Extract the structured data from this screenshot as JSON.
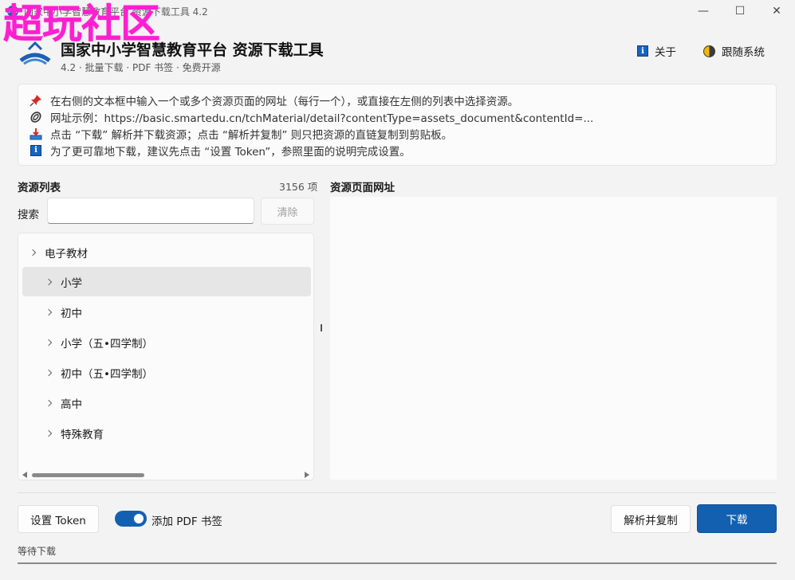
{
  "window": {
    "title": "国家中小学智慧教育平台 资源下载工具 4.2",
    "controls": {
      "minimize": "—",
      "maximize": "☐",
      "close": "✕"
    }
  },
  "watermark": "超玩社区",
  "header": {
    "title": "国家中小学智慧教育平台 资源下载工具",
    "subtitle": "4.2 · 批量下载 · PDF 书签 · 免费开源",
    "about_label": "关于",
    "theme_label": "跟随系统"
  },
  "info": {
    "lines": [
      {
        "icon": "pin-icon",
        "text": "在右侧的文本框中输入一个或多个资源页面的网址（每行一个），或直接在左侧的列表中选择资源。"
      },
      {
        "icon": "paperclip-icon",
        "text": "网址示例：https://basic.smartedu.cn/tchMaterial/detail?contentType=assets_document&contentId=..."
      },
      {
        "icon": "download-tray-icon",
        "text": "点击 “下载” 解析并下载资源；点击 “解析并复制” 则只把资源的直链复制到剪贴板。"
      },
      {
        "icon": "info-icon",
        "text": "为了更可靠地下载，建议先点击 “设置 Token”，参照里面的说明完成设置。"
      }
    ]
  },
  "resources": {
    "label": "资源列表",
    "count": "3156 项",
    "search_label": "搜索",
    "search_value": "",
    "clear_label": "清除",
    "tree": [
      {
        "label": "电子教材",
        "level": 0,
        "selected": false
      },
      {
        "label": "小学",
        "level": 1,
        "selected": true
      },
      {
        "label": "初中",
        "level": 1,
        "selected": false
      },
      {
        "label": "小学（五•四学制）",
        "level": 1,
        "selected": false
      },
      {
        "label": "初中（五•四学制）",
        "level": 1,
        "selected": false
      },
      {
        "label": "高中",
        "level": 1,
        "selected": false
      },
      {
        "label": "特殊教育",
        "level": 1,
        "selected": false
      }
    ]
  },
  "url_panel": {
    "label": "资源页面网址",
    "value": ""
  },
  "footer": {
    "token_button": "设置 Token",
    "pdf_toggle_label": "添加 PDF 书签",
    "pdf_toggle_on": true,
    "parse_copy_button": "解析并复制",
    "download_button": "下载",
    "status": "等待下载"
  },
  "colors": {
    "accent": "#1460b0",
    "watermark": "#ff1ed0",
    "background": "#f3f3f3"
  }
}
